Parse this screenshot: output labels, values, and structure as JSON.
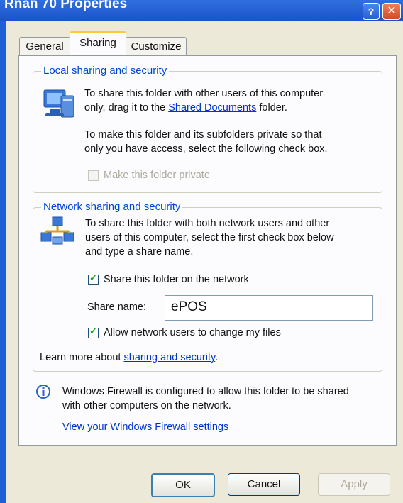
{
  "window": {
    "title": "Rnan 70 Properties",
    "help_button": "?",
    "close_button": "✕"
  },
  "tabs": [
    {
      "label": "General"
    },
    {
      "label": "Sharing",
      "active": true
    },
    {
      "label": "Customize"
    }
  ],
  "local": {
    "legend": "Local sharing and security",
    "text1_a": "To share this folder with other users of this computer",
    "text1_b": "only, drag it to the",
    "text1_link": "Shared Documents",
    "text1_c": "folder.",
    "text2_a": "To make this folder and its subfolders private so that",
    "text2_b": "only you have access, select the following check box.",
    "private_checkbox": {
      "label": "Make this folder private",
      "checked": false,
      "enabled": false
    }
  },
  "network": {
    "legend": "Network sharing and security",
    "text_a": "To share this folder with both network users and other",
    "text_b": "users of this computer, select the first check box below",
    "text_c": "and type a share name.",
    "share_checkbox": {
      "label": "Share this folder on the network",
      "checked": true
    },
    "share_name_label": "Share name:",
    "share_name_value": "ePOS",
    "allow_checkbox": {
      "label": "Allow network users to change my files",
      "checked": true
    },
    "learn_more_prefix": "Learn more about",
    "learn_more_link": "sharing and security",
    "learn_more_suffix": "."
  },
  "firewall": {
    "text_a": "Windows Firewall is configured to allow this folder to be shared",
    "text_b": "with other computers on the network.",
    "link": "View your Windows Firewall settings"
  },
  "buttons": {
    "ok": "OK",
    "cancel": "Cancel",
    "apply": "Apply"
  }
}
